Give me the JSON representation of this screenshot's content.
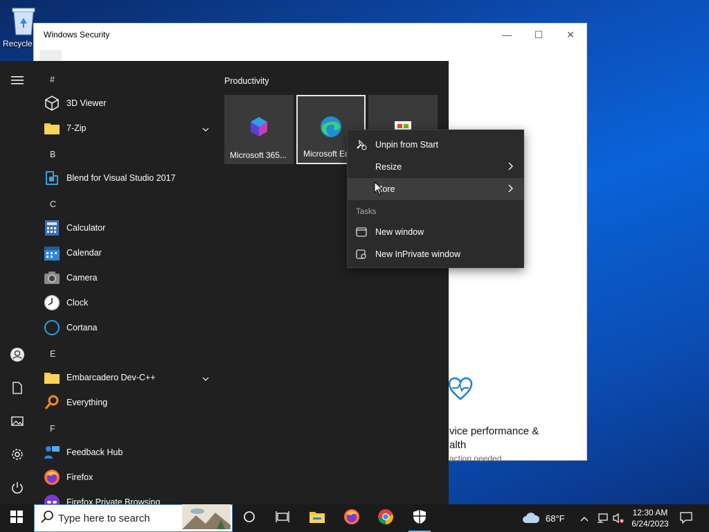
{
  "desktop": {
    "recycle_bin_label": "Recycle Bin"
  },
  "security_window": {
    "title": "Windows Security",
    "controls": {
      "minimize": "—",
      "maximize": "☐",
      "close": "✕"
    },
    "back_glyph": "←",
    "card_line1": "vice performance &",
    "card_line2": "alth",
    "card_status": "action needed"
  },
  "start_menu": {
    "rail": [
      "hamburger-icon",
      "user-icon",
      "documents-icon",
      "pictures-icon",
      "settings-icon",
      "power-icon"
    ],
    "letters": [
      "#",
      "B",
      "C",
      "E",
      "F"
    ],
    "apps": [
      {
        "label": "3D Viewer",
        "icon": "cube-icon"
      },
      {
        "label": "7-Zip",
        "icon": "folder-icon",
        "expandable": true
      },
      {
        "label": "Blend for Visual Studio 2017",
        "icon": "blend-icon"
      },
      {
        "label": "Calculator",
        "icon": "calculator-icon"
      },
      {
        "label": "Calendar",
        "icon": "calendar-icon"
      },
      {
        "label": "Camera",
        "icon": "camera-icon"
      },
      {
        "label": "Clock",
        "icon": "clock-icon"
      },
      {
        "label": "Cortana",
        "icon": "cortana-icon"
      },
      {
        "label": "Embarcadero Dev-C++",
        "icon": "folder-icon",
        "expandable": true
      },
      {
        "label": "Everything",
        "icon": "search-icon"
      },
      {
        "label": "Feedback Hub",
        "icon": "feedback-icon"
      },
      {
        "label": "Firefox",
        "icon": "firefox-icon"
      },
      {
        "label": "Firefox Private Browsing",
        "icon": "firefox-private-icon"
      }
    ],
    "group_title": "Productivity",
    "tiles": [
      {
        "label": "Microsoft 365...",
        "icon": "m365-icon"
      },
      {
        "label": "Microsoft Ed",
        "icon": "edge-icon"
      },
      {
        "label": "",
        "icon": "store-icon"
      }
    ]
  },
  "context_menu": {
    "items": [
      {
        "label": "Unpin from Start",
        "icon": "unpin-icon"
      },
      {
        "label": "Resize",
        "submenu": true
      },
      {
        "label": "More",
        "submenu": true
      }
    ],
    "tasks_header": "Tasks",
    "tasks": [
      {
        "label": "New window",
        "icon": "window-icon"
      },
      {
        "label": "New InPrivate window",
        "icon": "inprivate-icon"
      }
    ]
  },
  "taskbar": {
    "search_placeholder": "Type here to search",
    "weather": "68°F",
    "time": "12:30 AM",
    "date": "6/24/2023",
    "accent": "#76b9ed"
  }
}
